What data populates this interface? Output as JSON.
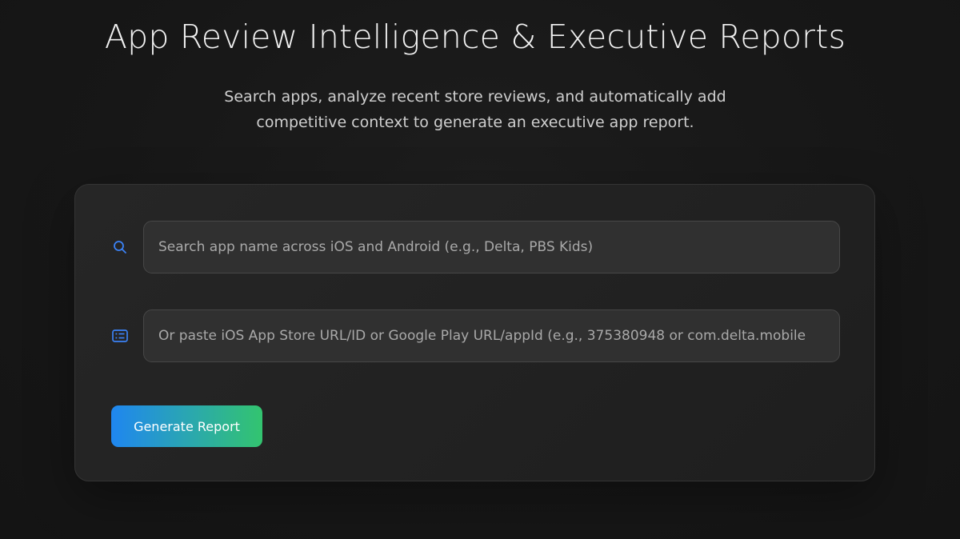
{
  "header": {
    "title": "App Review Intelligence & Executive Reports",
    "subtitle_line1": "Search apps, analyze recent store reviews, and automatically add",
    "subtitle_line2": "competitive context to generate an executive app report."
  },
  "form": {
    "search": {
      "icon": "search-icon",
      "value": "",
      "placeholder": "Search app name across iOS and Android (e.g., Delta, PBS Kids)"
    },
    "url": {
      "icon": "list-icon",
      "value": "",
      "placeholder": "Or paste iOS App Store URL/ID or Google Play URL/appId (e.g., 375380948 or com.delta.mobile"
    },
    "generate_label": "Generate Report"
  },
  "colors": {
    "background": "#161616",
    "card": "#242424",
    "icon_accent": "#3b82f6",
    "button_gradient_start": "#1f86f0",
    "button_gradient_end": "#33c46f"
  }
}
